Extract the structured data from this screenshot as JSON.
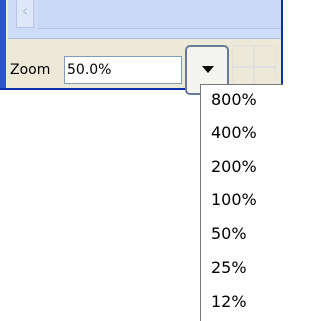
{
  "zoom": {
    "label": "Zoom",
    "value": "50.0%",
    "options": [
      "800%",
      "400%",
      "200%",
      "100%",
      "50%",
      "25%",
      "12%"
    ]
  },
  "scrollbar": {
    "left_arrow_icon": "chevron-left-icon"
  },
  "dropdown": {
    "button_icon": "chevron-down-icon"
  },
  "colors": {
    "panel_bg": "#ece9d8",
    "accent_blue": "#0a2fa8",
    "field_border": "#7f9db9"
  }
}
